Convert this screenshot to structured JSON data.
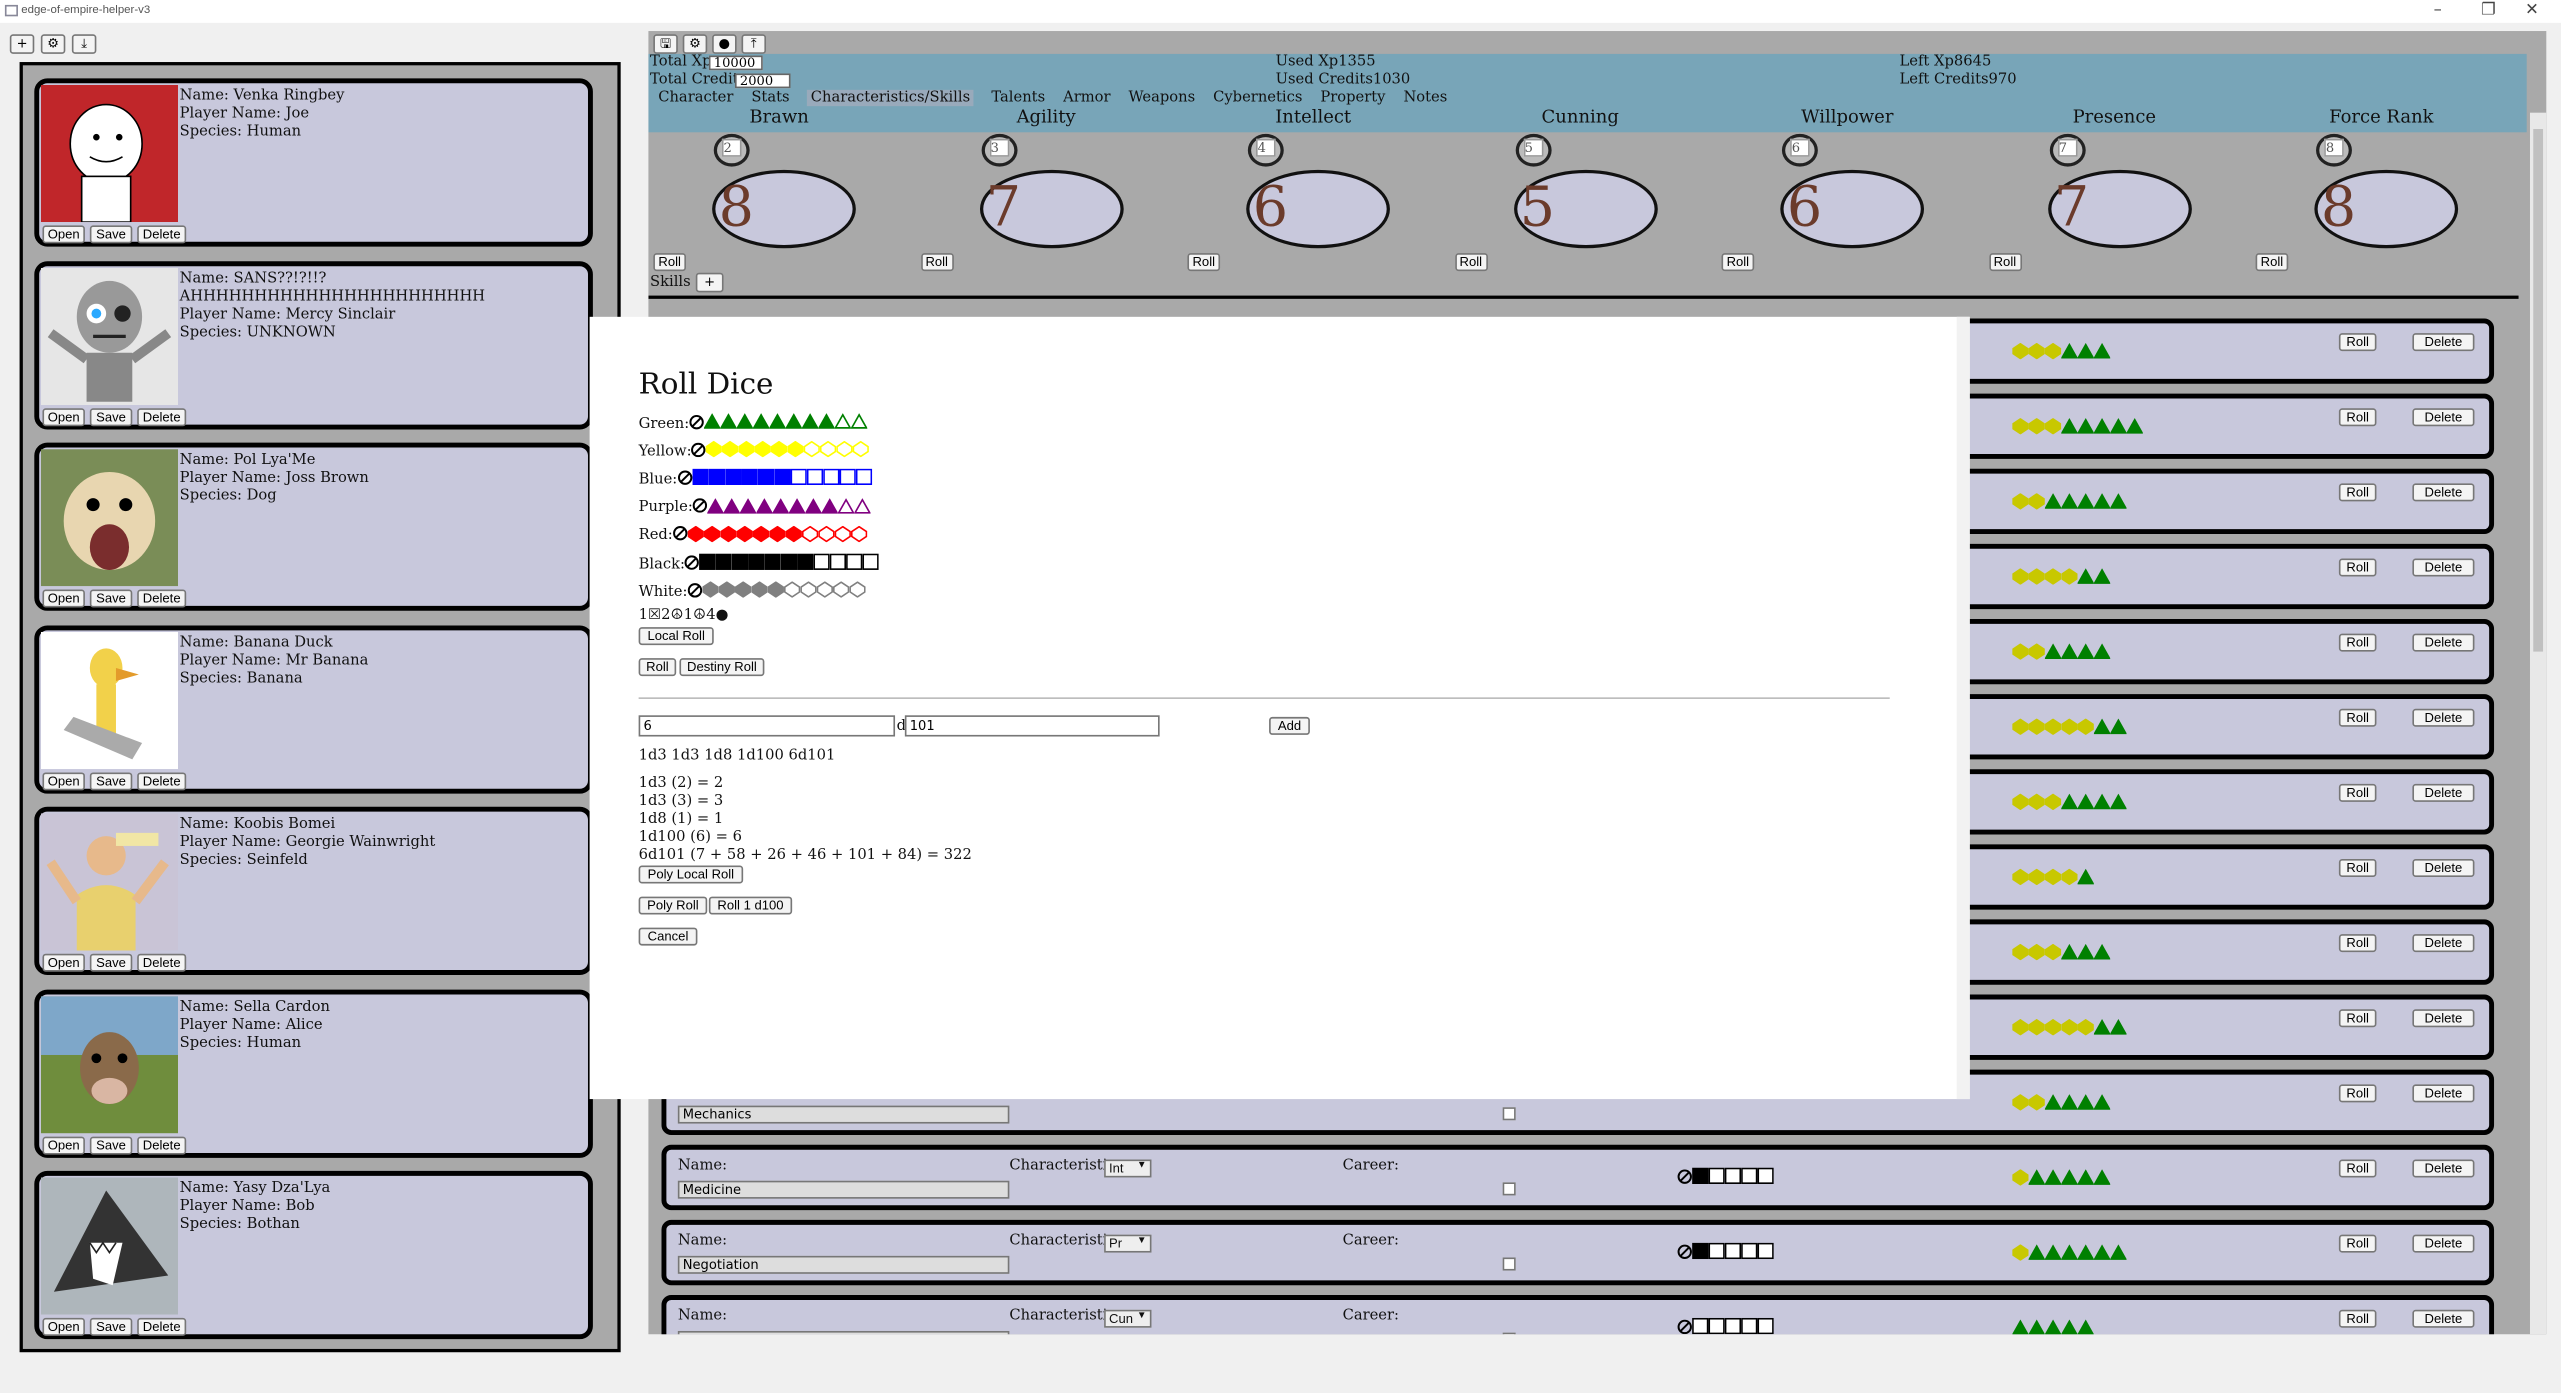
{
  "window": {
    "title": "edge-of-empire-helper-v3",
    "controls": [
      "–",
      "❐",
      "✕"
    ]
  },
  "left_toolbar": [
    {
      "icon": "plus-icon",
      "glyph": "+"
    },
    {
      "icon": "gear-icon",
      "glyph": "⚙"
    },
    {
      "icon": "download-icon",
      "glyph": "⤓"
    }
  ],
  "right_toolbar": [
    {
      "icon": "save-icon",
      "glyph": "🖫"
    },
    {
      "icon": "gear-icon",
      "glyph": "⚙"
    },
    {
      "icon": "record-icon",
      "glyph": "●"
    },
    {
      "icon": "upload-icon",
      "glyph": "⤒"
    }
  ],
  "card_buttons": {
    "open": "Open",
    "save": "Save",
    "delete": "Delete"
  },
  "characters": [
    {
      "name": "Name: Venka Ringbey",
      "player": "Player Name: Joe",
      "species": "Species: Human"
    },
    {
      "name": "Name: SANS??!?!!? AHHHHHHHHHHHHHHHHHHHHHHH",
      "player": "Player Name: Mercy Sinclair",
      "species": "Species: UNKNOWN"
    },
    {
      "name": "Name: Pol Lya'Me",
      "player": "Player Name: Joss Brown",
      "species": "Species: Dog"
    },
    {
      "name": "Name: Banana Duck",
      "player": "Player Name: Mr Banana",
      "species": "Species: Banana"
    },
    {
      "name": "Name: Koobis Bomei",
      "player": "Player Name: Georgie Wainwright",
      "species": "Species: Seinfeld"
    },
    {
      "name": "Name: Sella Cardon",
      "player": "Player Name: Alice",
      "species": "Species: Human"
    },
    {
      "name": "Name: Yasy Dza'Lya",
      "player": "Player Name: Bob",
      "species": "Species: Bothan"
    }
  ],
  "header": {
    "total_xp_label": "Total Xp",
    "total_xp_value": "10000",
    "total_credits_label": "Total Credits",
    "total_credits_value": "2000",
    "used_xp": "Used Xp1355",
    "used_credits": "Used Credits1030",
    "left_xp": "Left Xp8645",
    "left_credits": "Left Credits970"
  },
  "tabs": [
    "Character",
    "Stats",
    "Characteristics/Skills",
    "Talents",
    "Armor",
    "Weapons",
    "Cybernetics",
    "Property",
    "Notes"
  ],
  "active_tab": "Characteristics/Skills",
  "characteristics": [
    {
      "name": "Brawn",
      "small": "2",
      "big": "8"
    },
    {
      "name": "Agility",
      "small": "3",
      "big": "7"
    },
    {
      "name": "Intellect",
      "small": "4",
      "big": "6"
    },
    {
      "name": "Cunning",
      "small": "5",
      "big": "5"
    },
    {
      "name": "Willpower",
      "small": "6",
      "big": "6"
    },
    {
      "name": "Presence",
      "small": "7",
      "big": "7"
    },
    {
      "name": "Force Rank",
      "small": "8",
      "big": "8"
    }
  ],
  "roll_label": "Roll",
  "delete_label": "Delete",
  "skills_label": "Skills",
  "skills": [
    {
      "yellow": 3,
      "green": 3
    },
    {
      "yellow": 3,
      "green": 5
    },
    {
      "yellow": 2,
      "green": 5
    },
    {
      "yellow": 4,
      "green": 2
    },
    {
      "yellow": 2,
      "green": 4
    },
    {
      "yellow": 5,
      "green": 2
    },
    {
      "yellow": 3,
      "green": 4
    },
    {
      "yellow": 4,
      "green": 1
    },
    {
      "yellow": 3,
      "green": 3
    },
    {
      "yellow": 5,
      "green": 2
    },
    {
      "yellow": 2,
      "green": 4,
      "name": "Mechanics"
    },
    {
      "yellow": 1,
      "green": 5,
      "name": "Medicine",
      "char": "Int",
      "rank": 1
    },
    {
      "yellow": 1,
      "green": 6,
      "name": "Negotiation",
      "char": "Pr",
      "rank": 1
    },
    {
      "yellow": 0,
      "green": 5,
      "name": "",
      "char": "Cun",
      "rank": 0
    }
  ],
  "skill_labels": {
    "name": "Name:",
    "characteristic": "Characteristic:",
    "career": "Career:"
  },
  "dialog": {
    "title": "Roll Dice",
    "dice": [
      {
        "label": "Green:",
        "color": "#008000",
        "shape": "triangle",
        "filled": 8,
        "empty": 2
      },
      {
        "label": "Yellow:",
        "color": "#ffff00",
        "shape": "hexagon",
        "filled": 6,
        "empty": 4
      },
      {
        "label": "Blue:",
        "color": "#0000ff",
        "shape": "square",
        "filled": 6,
        "empty": 5
      },
      {
        "label": "Purple:",
        "color": "#800080",
        "shape": "triangle",
        "filled": 8,
        "empty": 2
      },
      {
        "label": "Red:",
        "color": "#ff0000",
        "shape": "hexagon",
        "filled": 7,
        "empty": 4
      },
      {
        "label": "Black:",
        "color": "#000000",
        "shape": "square",
        "filled": 7,
        "empty": 4
      },
      {
        "label": "White:",
        "color": "#808080",
        "shape": "hexagon",
        "filled": 5,
        "empty": 5
      }
    ],
    "force_summary": "1☒2☮1☮4●",
    "local_roll": "Local Roll",
    "roll": "Roll",
    "destiny_roll": "Destiny Roll",
    "count_value": "6",
    "d_label": "d",
    "sides_value": "101",
    "add": "Add",
    "pool": "1d3 1d3 1d8 1d100 6d101",
    "results": [
      "1d3 (2) = 2",
      "1d3 (3) = 3",
      "1d8 (1) = 1",
      "1d100 (6) = 6",
      "6d101 (7 + 58 + 26 + 46 + 101 + 84) = 322"
    ],
    "poly_local_roll": "Poly Local Roll",
    "poly_roll": "Poly Roll",
    "roll_1_d100": "Roll 1 d100",
    "cancel": "Cancel"
  }
}
